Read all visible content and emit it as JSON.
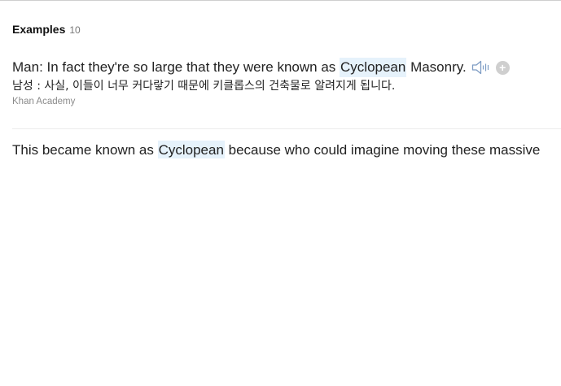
{
  "examples_section": {
    "title": "Examples",
    "count": "10"
  },
  "example1": {
    "before": "Man: In fact they're so large that they were known as ",
    "highlight": "Cyclopean",
    "after": " Masonry.",
    "translation": "남성 : 사실, 이들이 너무 커다랗기 때문에 키클롭스의 건축물로 알려지게 됩니다.",
    "source": "Khan Academy"
  },
  "example2": {
    "before": "This became known as ",
    "highlight": "Cyclopean",
    "after": " because who could imagine moving these massive"
  },
  "icons": {
    "audio": "speaker-icon",
    "add": "plus-icon"
  },
  "colors": {
    "highlight": "#e6f2fb",
    "divider": "#ececec"
  }
}
